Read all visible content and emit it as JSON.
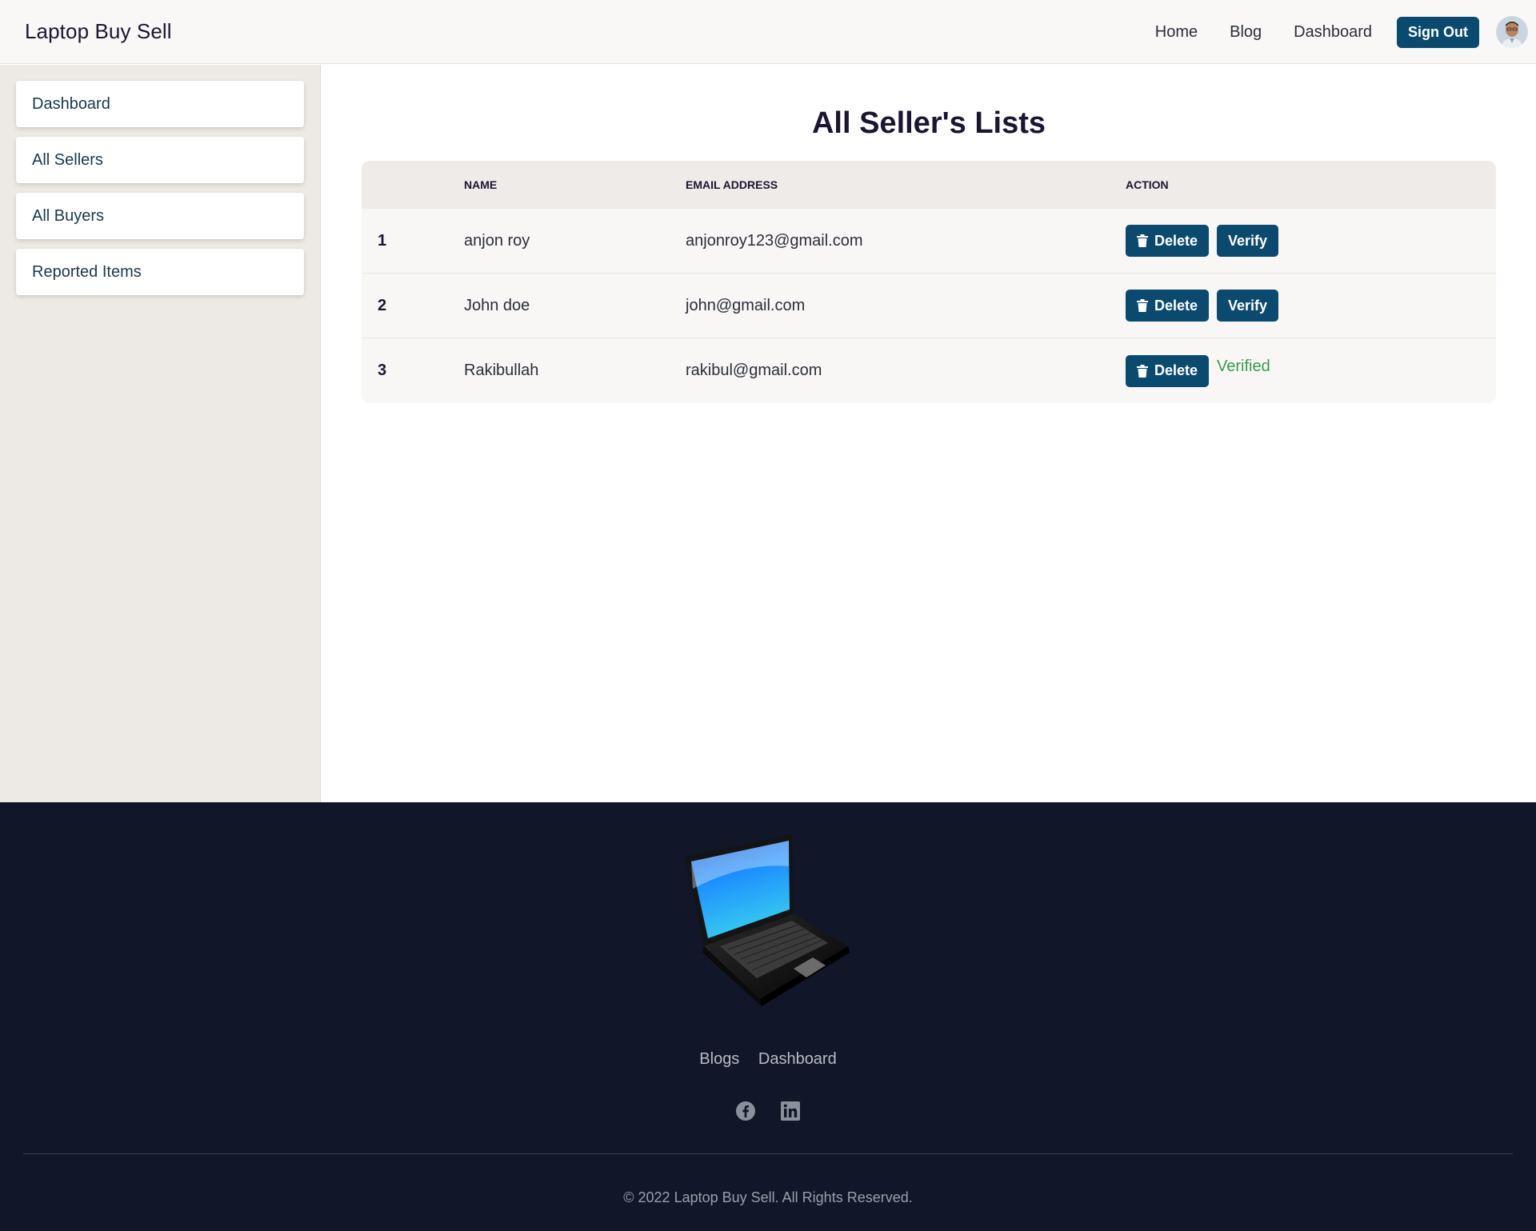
{
  "navbar": {
    "brand": "Laptop Buy Sell",
    "links": [
      "Home",
      "Blog",
      "Dashboard"
    ],
    "signout_label": "Sign Out"
  },
  "sidebar": {
    "items": [
      "Dashboard",
      "All Sellers",
      "All Buyers",
      "Reported Items"
    ]
  },
  "main": {
    "title": "All Seller's Lists",
    "columns": [
      "",
      "NAME",
      "EMAIL ADDRESS",
      "ACTION"
    ],
    "rows": [
      {
        "index": "1",
        "name": "anjon roy",
        "email": "anjonroy123@gmail.com",
        "delete_label": "Delete",
        "verify_label": "Verify",
        "verified": false
      },
      {
        "index": "2",
        "name": "John doe",
        "email": "john@gmail.com",
        "delete_label": "Delete",
        "verify_label": "Verify",
        "verified": false
      },
      {
        "index": "3",
        "name": "Rakibullah",
        "email": "rakibul@gmail.com",
        "delete_label": "Delete",
        "verified_label": "Verified",
        "verified": true
      }
    ]
  },
  "footer": {
    "links": [
      "Blogs",
      "Dashboard"
    ],
    "socials": [
      "facebook-icon",
      "linkedin-icon"
    ],
    "copyright": "© 2022 Laptop Buy Sell. All Rights Reserved."
  },
  "colors": {
    "primary": "#0b4a6f",
    "verified": "#3a9a4e",
    "footer_bg": "#111728",
    "sidebar_bg": "#edeae6"
  }
}
